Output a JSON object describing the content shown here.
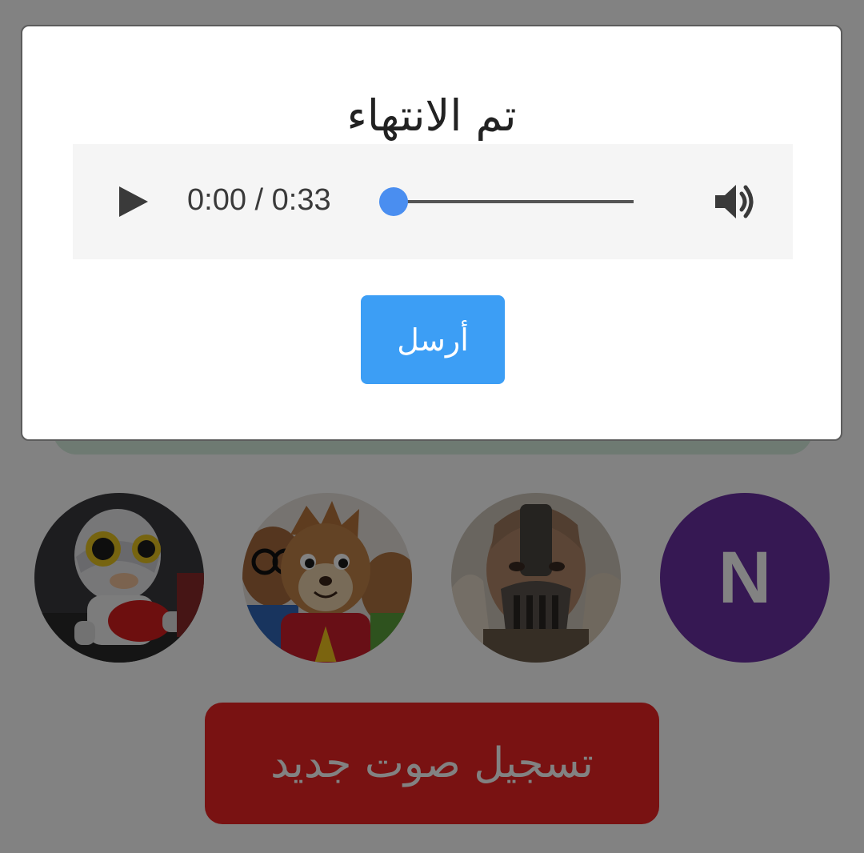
{
  "modal": {
    "title": "تم الانتهاء",
    "send_label": "أرسل"
  },
  "audio_player": {
    "time_display": "0:00 / 0:33",
    "current_time": "0:00",
    "duration": "0:33",
    "progress_fraction": 0.0,
    "play_icon": "play-icon",
    "volume_icon": "volume-icon",
    "accent_color": "#4a8ef0"
  },
  "participants": [
    {
      "kind": "photo",
      "icon": "robot-avatar-photo"
    },
    {
      "kind": "photo",
      "icon": "chipmunks-avatar-photo"
    },
    {
      "kind": "photo",
      "icon": "masked-man-avatar-photo"
    },
    {
      "kind": "initial",
      "initial": "N",
      "color": "#6b2fa3"
    }
  ],
  "record_button": {
    "label": "تسجيل صوت جديد",
    "color": "#ee2525"
  },
  "colors": {
    "send_button": "#3c9ef5",
    "overlay": "rgba(0,0,0,0.49)",
    "banner": "#d8efe0"
  }
}
